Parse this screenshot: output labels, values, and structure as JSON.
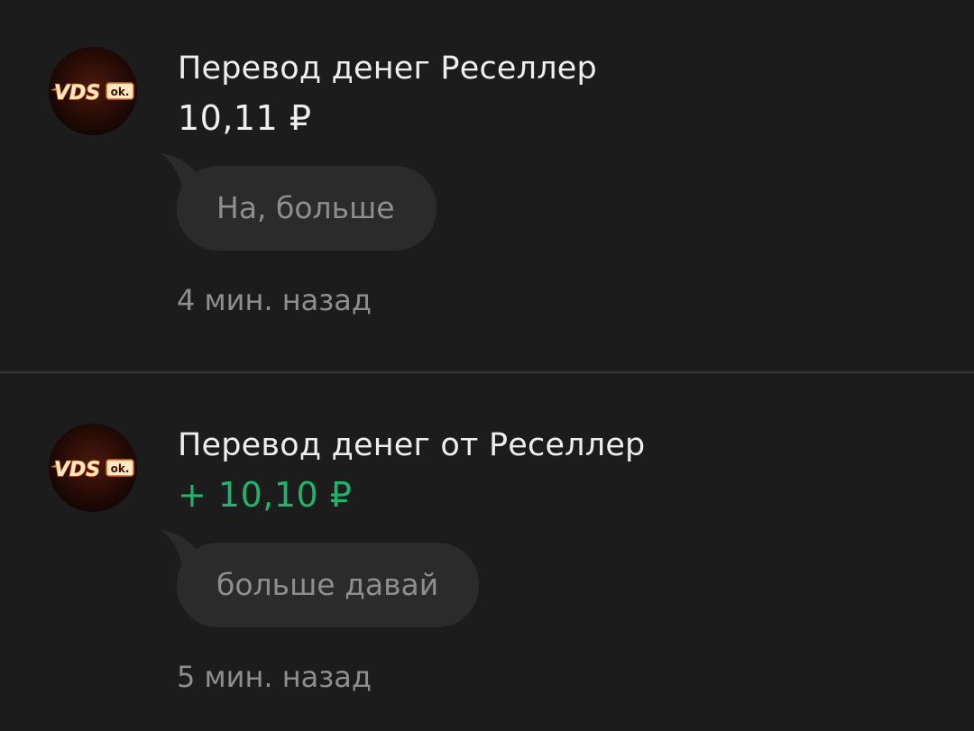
{
  "transactions": [
    {
      "avatar_text": "VDS",
      "avatar_badge": "ok.",
      "avatar_icon": "vdsok-logo-icon",
      "title": "Перевод денег Реселлер",
      "amount": "10,11 ₽",
      "amount_color": "#eeeeee",
      "message": "На, больше",
      "time": "4 мин. назад"
    },
    {
      "avatar_text": "VDS",
      "avatar_badge": "ok.",
      "avatar_icon": "vdsok-logo-icon",
      "title": "Перевод денег от Реселлер",
      "amount": "+ 10,10 ₽",
      "amount_color": "#21b36b",
      "message": "больше давай",
      "time": "5 мин. назад"
    }
  ]
}
